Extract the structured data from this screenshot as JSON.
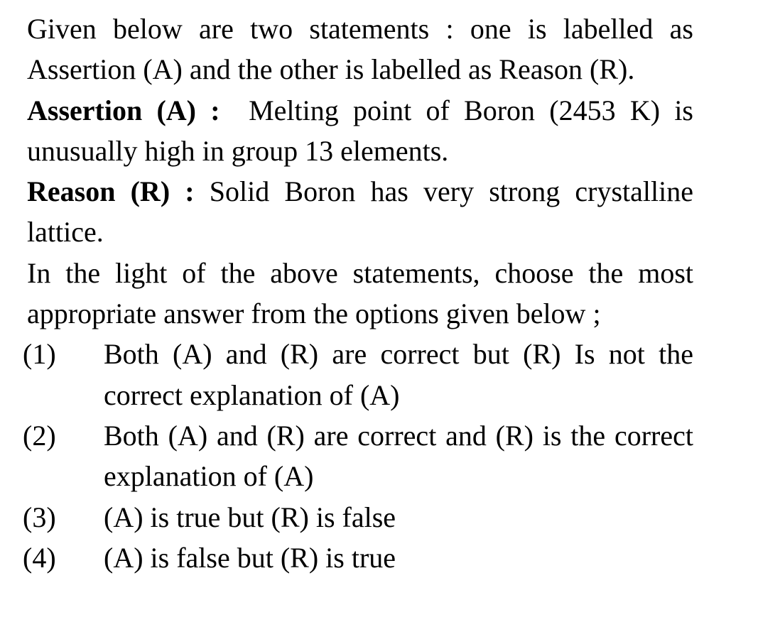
{
  "intro": "Given below are two statements : one is labelled as Assertion (A) and the other is labelled as Reason (R).",
  "assertion": {
    "label": "Assertion (A) :",
    "text": "Melting point of Boron (2453 K) is unusually high in group 13 elements."
  },
  "reason": {
    "label": "Reason (R) :",
    "text": "Solid Boron has very strong crystalline lattice."
  },
  "instruction": "In the light of the above statements, choose the most appropriate answer from the options given below ;",
  "options": [
    {
      "number": "(1)",
      "text": "Both (A) and (R) are correct but (R) Is not the correct explanation of (A)"
    },
    {
      "number": "(2)",
      "text": "Both (A) and (R) are correct and (R) is the correct explanation of (A)"
    },
    {
      "number": "(3)",
      "text": "(A) is true but (R) is false"
    },
    {
      "number": "(4)",
      "text": "(A) is false but (R) is true"
    }
  ]
}
